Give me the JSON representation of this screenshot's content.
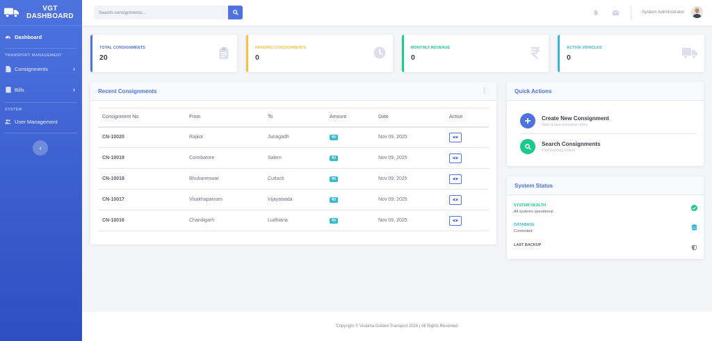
{
  "brand": {
    "line1": "VGT",
    "line2": "DASHBOARD"
  },
  "sidebar": {
    "dashboard": "Dashboard",
    "heading_transport": "TRANSPORT MANAGEMENT",
    "consignments": "Consignments",
    "bills": "Bills",
    "heading_system": "SYSTEM",
    "user_management": "User Management",
    "toggle": "‹"
  },
  "topbar": {
    "search_placeholder": "Search consignments...",
    "user_name": "System Administrator"
  },
  "stats": [
    {
      "label": "TOTAL CONSIGNMENTS",
      "value": "20",
      "color": "#4e73df",
      "icon": "clipboard-icon"
    },
    {
      "label": "PENDING CONSIGNMENTS",
      "value": "0",
      "color": "#f6c23e",
      "icon": "clock-icon"
    },
    {
      "label": "MONTHLY REVENUE",
      "value": "0",
      "color": "#1cc88a",
      "icon": "rupee-icon"
    },
    {
      "label": "ACTIVE VEHICLES",
      "value": "0",
      "color": "#36b9cc",
      "icon": "truck-icon"
    }
  ],
  "recent": {
    "title": "Recent Consignments",
    "columns": [
      "Consignment No.",
      "From",
      "To",
      "Amount",
      "Date",
      "Action"
    ],
    "rows": [
      {
        "no": "CN-10020",
        "from": "Rajkot",
        "to": "Junagadh",
        "amount": "₹0",
        "date": "Nov 09, 2025"
      },
      {
        "no": "CN-10019",
        "from": "Coimbatore",
        "to": "Salem",
        "amount": "₹0",
        "date": "Nov 09, 2025"
      },
      {
        "no": "CN-10018",
        "from": "Bhubaneswar",
        "to": "Cuttack",
        "amount": "₹0",
        "date": "Nov 09, 2025"
      },
      {
        "no": "CN-10017",
        "from": "Visakhapatnam",
        "to": "Vijayawada",
        "amount": "₹0",
        "date": "Nov 09, 2025"
      },
      {
        "no": "CN-10016",
        "from": "Chandigarh",
        "to": "Ludhiana",
        "amount": "₹0",
        "date": "Nov 09, 2025"
      }
    ]
  },
  "quick_actions": {
    "title": "Quick Actions",
    "create_title": "Create New Consignment",
    "create_sub": "Start a new transport order",
    "search_title": "Search Consignments",
    "search_sub": "Find existing orders"
  },
  "system_status": {
    "title": "System Status",
    "health_label": "SYSTEM HEALTH",
    "health_sub": "All systems operational",
    "db_label": "DATABASE",
    "db_sub": "Connected",
    "backup_label": "LAST BACKUP"
  },
  "footer": "Copyright © Visakha Golden Transport 2026 | All Rights Reserved",
  "colors": {
    "primary": "#4e73df",
    "success": "#1cc88a",
    "info": "#36b9cc",
    "warning": "#f6c23e"
  }
}
